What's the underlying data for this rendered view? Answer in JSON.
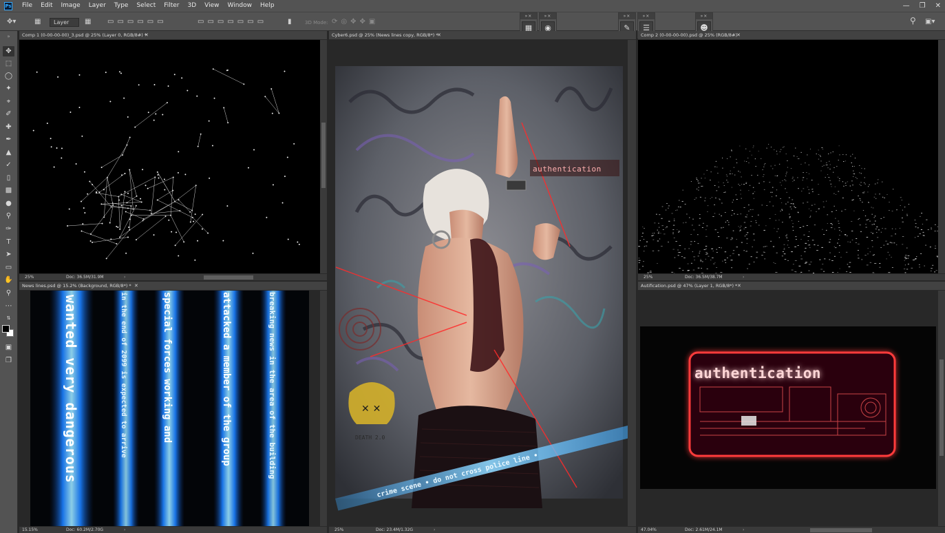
{
  "app": {
    "logo": "Ps",
    "menu": [
      "File",
      "Edit",
      "Image",
      "Layer",
      "Type",
      "Select",
      "Filter",
      "3D",
      "View",
      "Window",
      "Help"
    ],
    "window_controls": [
      "minimize-icon",
      "restore-icon",
      "close-icon"
    ]
  },
  "options_bar": {
    "auto_select_value": "Layer",
    "mode_label": "3D Mode:"
  },
  "documents": {
    "comp1": {
      "title": "Comp 1 (0-00-00-00)_3.psd @ 25% (Layer 0, RGB/8#) *",
      "zoom": "25%",
      "doc": "Doc: 36.5M/31.9M"
    },
    "news": {
      "title": "News lines.psd @ 15.2% (Background, RGB/8*) *",
      "zoom": "15.15%",
      "doc": "Doc: 60.2M/2.70G"
    },
    "cyber": {
      "title": "Cyber6.psd @ 25% (News lines copy, RGB/8*) *",
      "zoom": "25%",
      "doc": "Doc: 23.4M/1.32G"
    },
    "comp2": {
      "title": "Comp 2 (0-00-00-00).psd @ 25% (RGB/8#)",
      "zoom": "25%",
      "doc": "Doc: 36.5M/38.7M"
    },
    "auth": {
      "title": "Autification.psd @ 47% (Layer 1, RGB/8*) *",
      "zoom": "47.04%",
      "doc": "Doc: 2.61M/24.1M"
    }
  },
  "artwork": {
    "news_columns": [
      "wanted very dangerous",
      "in the end of 2099 is expected to arrive",
      "special forces working and",
      "attacked a member of the group",
      "breaking news in the area of the building"
    ],
    "cyber_signage": "authentication",
    "cyber_tape": "crime scene • do not cross police line •",
    "cyber_skull_tag": "DEATH 2.0",
    "auth_title": "authentication"
  },
  "colors": {
    "chrome": "#535353",
    "workspace": "#282828",
    "neon_blue": "#3fb8ff",
    "neon_red": "#ff3a3a",
    "ps_blue": "#31a8ff"
  }
}
